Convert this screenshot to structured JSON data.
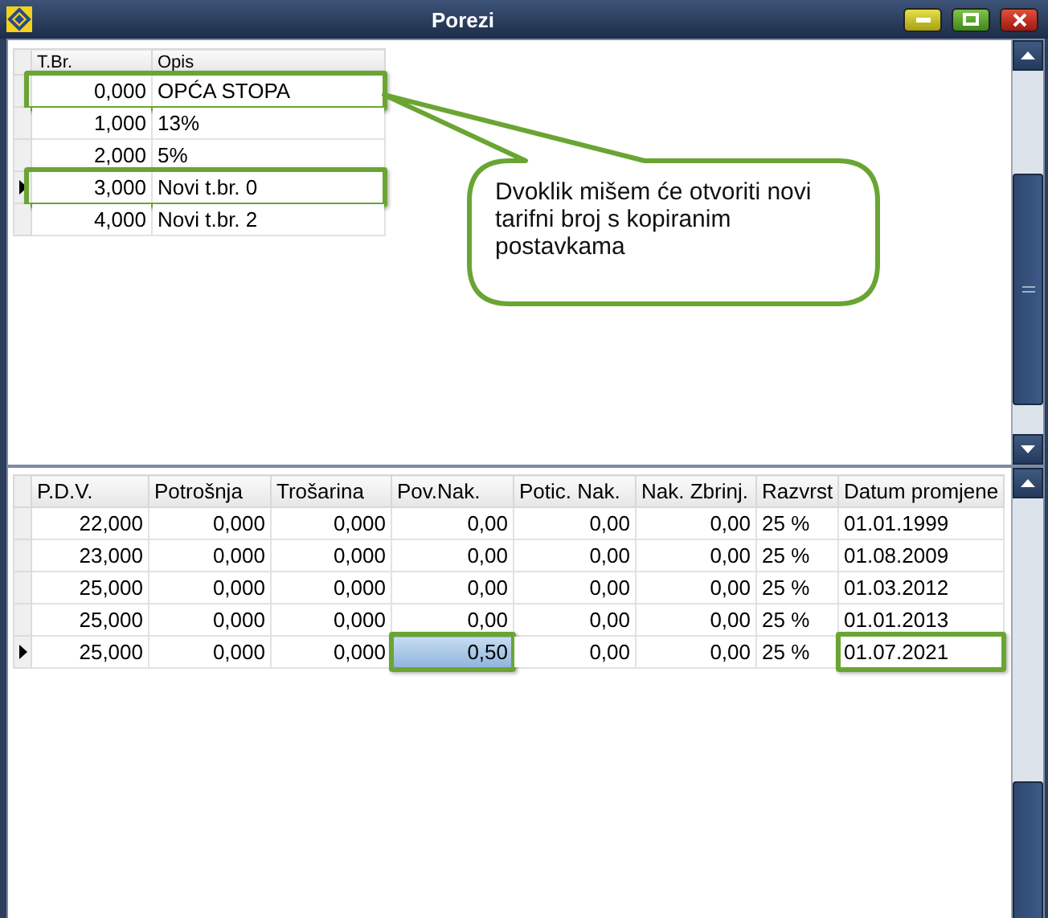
{
  "window": {
    "title": "Porezi"
  },
  "top_table": {
    "columns": [
      "T.Br.",
      "Opis"
    ],
    "rows": [
      {
        "cells": [
          "0,000",
          "OPĆA STOPA"
        ],
        "current": false,
        "highlighted": true
      },
      {
        "cells": [
          "1,000",
          "13%"
        ],
        "current": false,
        "highlighted": false
      },
      {
        "cells": [
          "2,000",
          "5%"
        ],
        "current": false,
        "highlighted": false
      },
      {
        "cells": [
          "3,000",
          "Novi t.br. 0"
        ],
        "current": true,
        "highlighted": true
      },
      {
        "cells": [
          "4,000",
          "Novi t.br. 2"
        ],
        "current": false,
        "highlighted": false
      }
    ]
  },
  "callout": {
    "text": "Dvoklik mišem će otvoriti novi tarifni broj s kopiranim postavkama"
  },
  "bottom_table": {
    "columns": [
      "P.D.V.",
      "Potrošnja",
      "Trošarina",
      "Pov.Nak.",
      "Potic. Nak.",
      "Nak. Zbrinj.",
      "Razvrst",
      "Datum promjene"
    ],
    "rows": [
      {
        "current": false,
        "cells": [
          {
            "text": "22,000",
            "selected": false,
            "highlighted": false
          },
          {
            "text": "0,000",
            "selected": false,
            "highlighted": false
          },
          {
            "text": "0,000",
            "selected": false,
            "highlighted": false
          },
          {
            "text": "0,00",
            "selected": false,
            "highlighted": false
          },
          {
            "text": "0,00",
            "selected": false,
            "highlighted": false
          },
          {
            "text": "0,00",
            "selected": false,
            "highlighted": false
          },
          {
            "text": "25 %",
            "selected": false,
            "highlighted": false
          },
          {
            "text": "01.01.1999",
            "selected": false,
            "highlighted": false
          }
        ]
      },
      {
        "current": false,
        "cells": [
          {
            "text": "23,000",
            "selected": false,
            "highlighted": false
          },
          {
            "text": "0,000",
            "selected": false,
            "highlighted": false
          },
          {
            "text": "0,000",
            "selected": false,
            "highlighted": false
          },
          {
            "text": "0,00",
            "selected": false,
            "highlighted": false
          },
          {
            "text": "0,00",
            "selected": false,
            "highlighted": false
          },
          {
            "text": "0,00",
            "selected": false,
            "highlighted": false
          },
          {
            "text": "25 %",
            "selected": false,
            "highlighted": false
          },
          {
            "text": "01.08.2009",
            "selected": false,
            "highlighted": false
          }
        ]
      },
      {
        "current": false,
        "cells": [
          {
            "text": "25,000",
            "selected": false,
            "highlighted": false
          },
          {
            "text": "0,000",
            "selected": false,
            "highlighted": false
          },
          {
            "text": "0,000",
            "selected": false,
            "highlighted": false
          },
          {
            "text": "0,00",
            "selected": false,
            "highlighted": false
          },
          {
            "text": "0,00",
            "selected": false,
            "highlighted": false
          },
          {
            "text": "0,00",
            "selected": false,
            "highlighted": false
          },
          {
            "text": "25 %",
            "selected": false,
            "highlighted": false
          },
          {
            "text": "01.03.2012",
            "selected": false,
            "highlighted": false
          }
        ]
      },
      {
        "current": false,
        "cells": [
          {
            "text": "25,000",
            "selected": false,
            "highlighted": false
          },
          {
            "text": "0,000",
            "selected": false,
            "highlighted": false
          },
          {
            "text": "0,000",
            "selected": false,
            "highlighted": false
          },
          {
            "text": "0,00",
            "selected": false,
            "highlighted": false
          },
          {
            "text": "0,00",
            "selected": false,
            "highlighted": false
          },
          {
            "text": "0,00",
            "selected": false,
            "highlighted": false
          },
          {
            "text": "25 %",
            "selected": false,
            "highlighted": false
          },
          {
            "text": "01.01.2013",
            "selected": false,
            "highlighted": false
          }
        ]
      },
      {
        "current": true,
        "cells": [
          {
            "text": "25,000",
            "selected": false,
            "highlighted": false
          },
          {
            "text": "0,000",
            "selected": false,
            "highlighted": false
          },
          {
            "text": "0,000",
            "selected": false,
            "highlighted": false
          },
          {
            "text": "0,50",
            "selected": true,
            "highlighted": true
          },
          {
            "text": "0,00",
            "selected": false,
            "highlighted": false
          },
          {
            "text": "0,00",
            "selected": false,
            "highlighted": false
          },
          {
            "text": "25 %",
            "selected": false,
            "highlighted": false
          },
          {
            "text": "01.07.2021",
            "selected": false,
            "highlighted": true
          }
        ]
      }
    ]
  }
}
